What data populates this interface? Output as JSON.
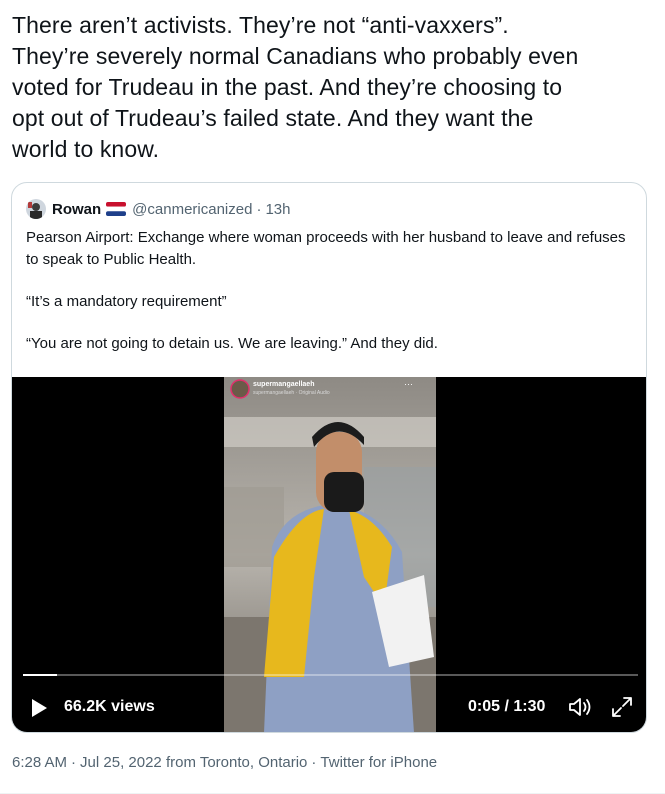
{
  "tweet": {
    "text": "There aren’t activists. They’re not “anti-vaxxers”.\nThey’re severely normal Canadians who probably even\nvoted for Trudeau in the past. And they’re choosing to\nopt out of Trudeau’s failed state. And they want the\nworld to know."
  },
  "quote": {
    "author_name": "Rowan",
    "handle": "@canmericanized",
    "separator": "·",
    "time": "13h",
    "flag_icon": "netherlands-flag-icon",
    "paragraphs": [
      "Pearson Airport: Exchange where woman proceeds with her husband to leave and refuses to speak to Public Health.",
      "“It’s a mandatory requirement”",
      "“You are not going to detain us. We are leaving.” And they did."
    ],
    "video": {
      "overlay_username": "supermangaellaeh",
      "overlay_audio": "supermangaellaeh · Original Audio",
      "overlay_more": "···",
      "views": "66.2K views",
      "time": "0:05 / 1:30",
      "progress": 0.056,
      "icons": {
        "play": "play-icon",
        "volume": "volume-icon",
        "fullscreen": "fullscreen-icon"
      }
    }
  },
  "meta": {
    "time": "6:28 AM",
    "dot1": "·",
    "date": "Jul 25, 2022 from Toronto, Ontario",
    "dot2": "·",
    "source": "Twitter for iPhone"
  },
  "colors": {
    "text": "#0f1419",
    "secondary": "#536471",
    "border": "#cfd9de"
  }
}
